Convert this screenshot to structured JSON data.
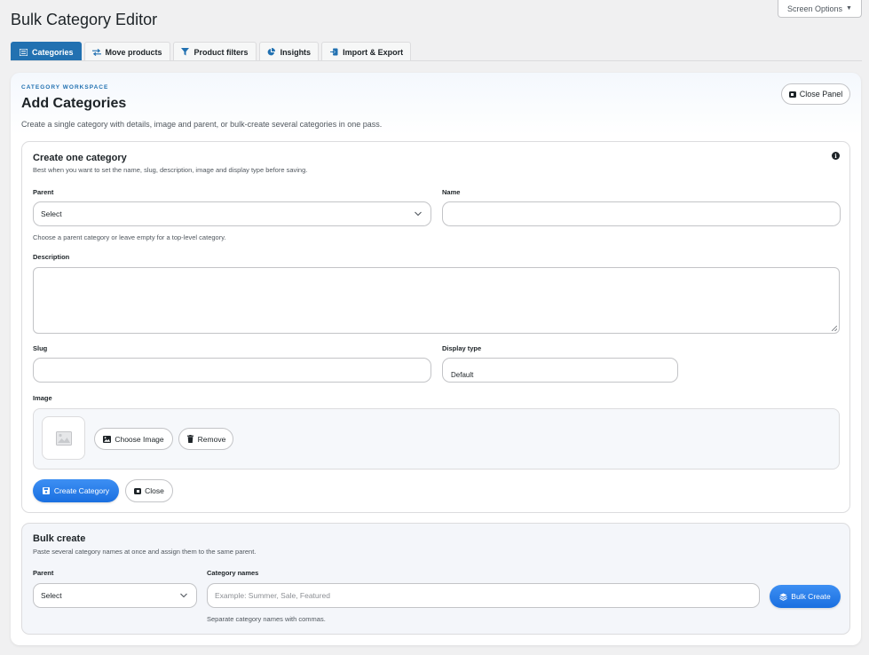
{
  "page": {
    "title": "Bulk Category Editor",
    "screen_options": "Screen Options"
  },
  "tabs": [
    {
      "label": "Categories",
      "icon": "list-icon",
      "active": true
    },
    {
      "label": "Move products",
      "icon": "arrows-swap-icon",
      "active": false
    },
    {
      "label": "Product filters",
      "icon": "filter-icon",
      "active": false
    },
    {
      "label": "Insights",
      "icon": "pie-chart-icon",
      "active": false
    },
    {
      "label": "Import & Export",
      "icon": "import-icon",
      "active": false
    }
  ],
  "workspace": {
    "kicker": "CATEGORY WORKSPACE",
    "title": "Add Categories",
    "subtitle": "Create a single category with details, image and parent, or bulk-create several categories in one pass.",
    "close_panel": "Close Panel"
  },
  "single": {
    "title": "Create one category",
    "subtitle": "Best when you want to set the name, slug, description, image and display type before saving.",
    "parent_label": "Parent",
    "parent_value": "Select",
    "parent_help": "Choose a parent category or leave empty for a top-level category.",
    "name_label": "Name",
    "name_value": "",
    "description_label": "Description",
    "slug_label": "Slug",
    "display_type_label": "Display type",
    "display_type_value": "Default",
    "image_label": "Image",
    "choose_image": "Choose Image",
    "remove": "Remove",
    "create_button": "Create Category",
    "close_button": "Close"
  },
  "bulk": {
    "title": "Bulk create",
    "subtitle": "Paste several category names at once and assign them to the same parent.",
    "parent_label": "Parent",
    "parent_value": "Select",
    "names_label": "Category names",
    "names_placeholder": "Example: Summer, Sale, Featured",
    "names_help": "Separate category names with commas.",
    "button": "Bulk Create"
  },
  "colors": {
    "accent": "#2271b1",
    "primary_button": "#2a7fe9",
    "background": "#f0f0f1"
  }
}
